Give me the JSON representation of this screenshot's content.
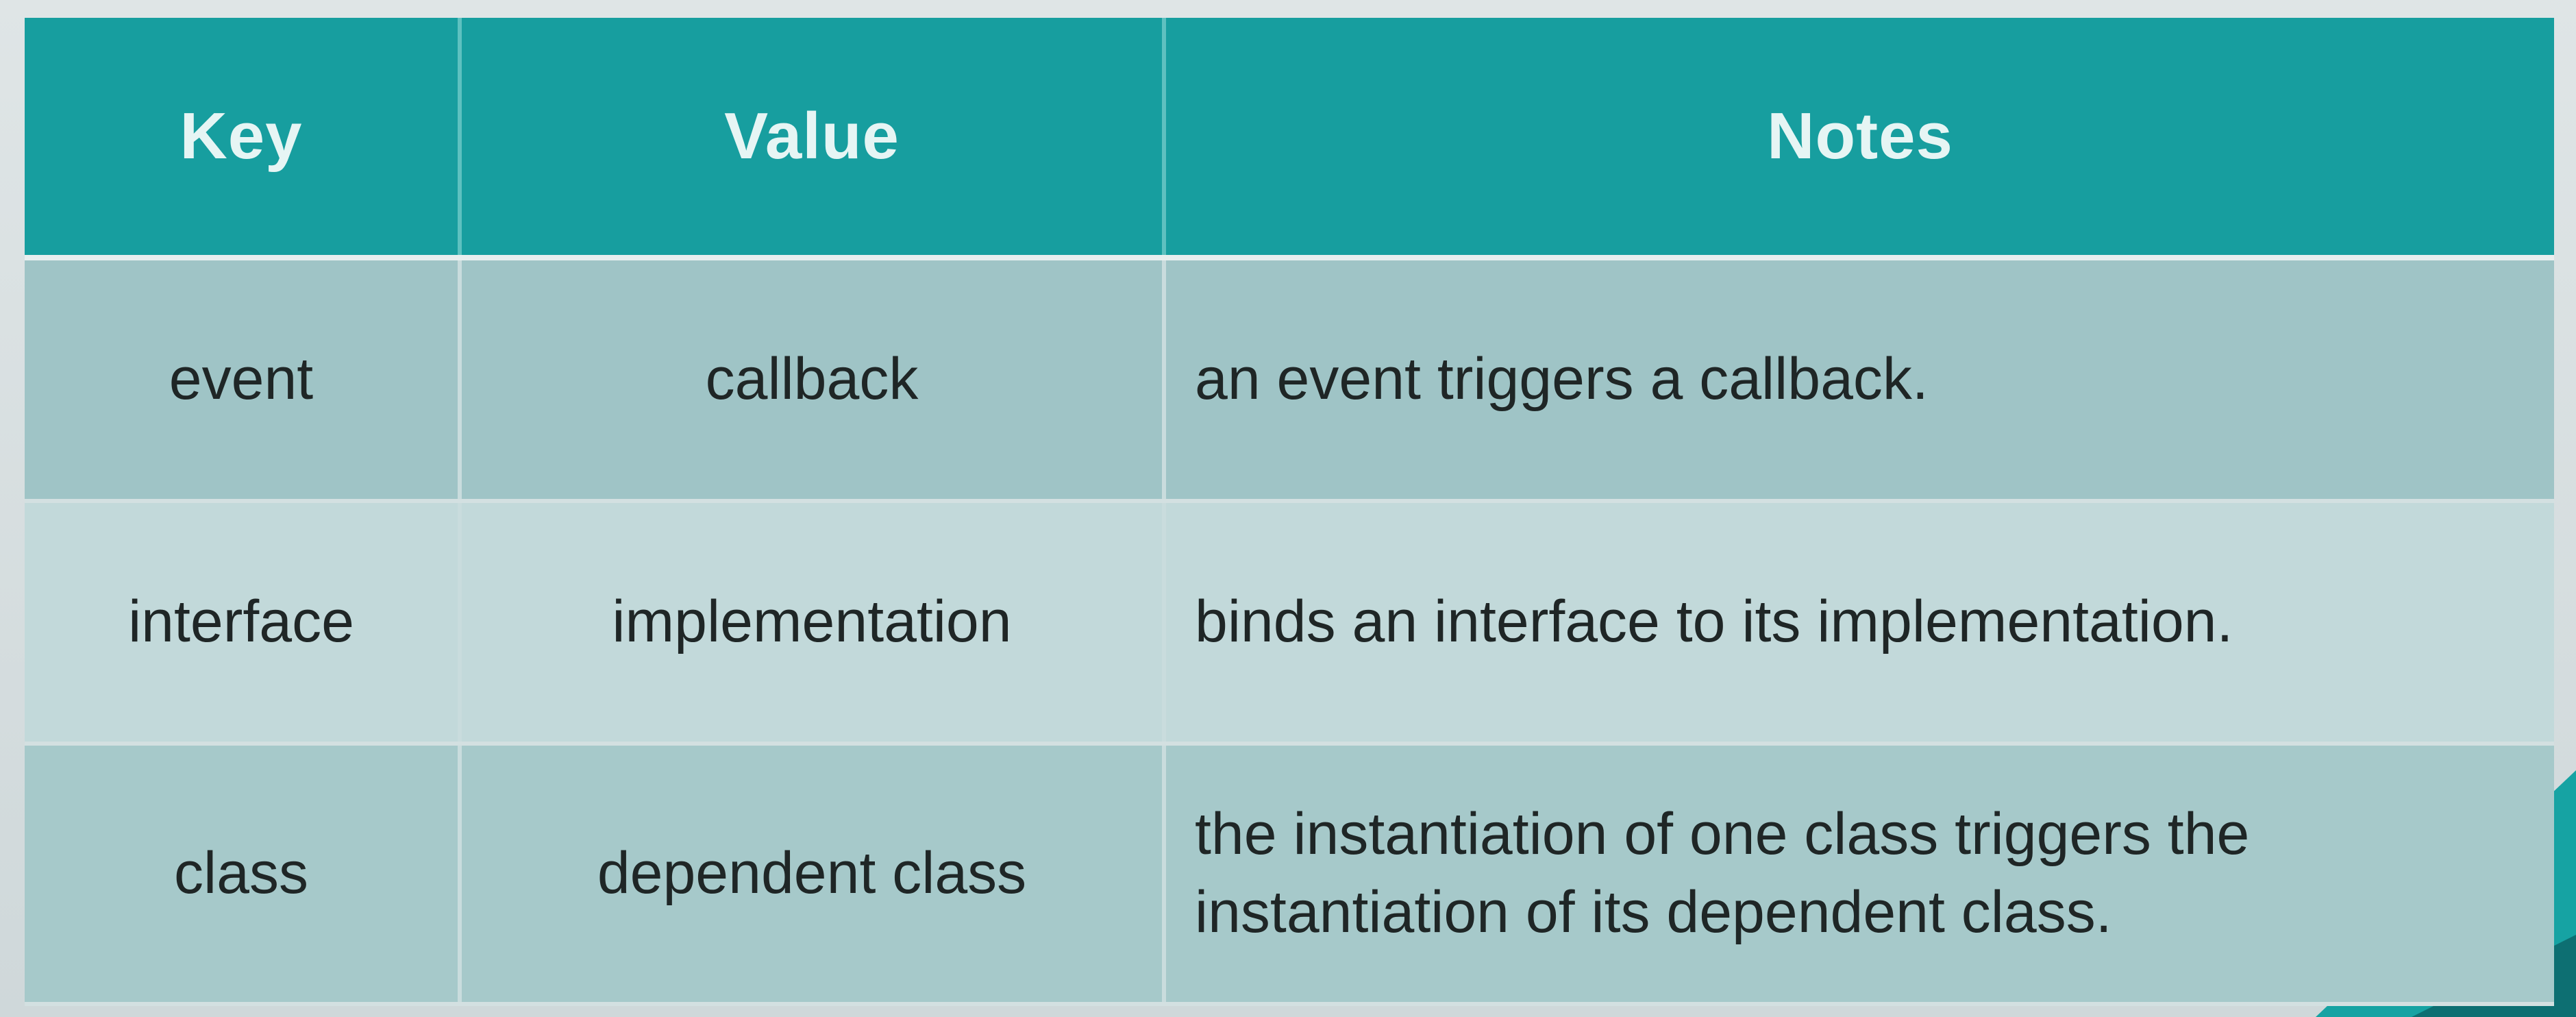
{
  "table": {
    "headers": {
      "key": "Key",
      "value": "Value",
      "notes": "Notes"
    },
    "rows": [
      {
        "key": "event",
        "value": "callback",
        "notes": "an event triggers a callback."
      },
      {
        "key": "interface",
        "value": "implementation",
        "notes": "binds an interface to its implementation."
      },
      {
        "key": "class",
        "value": "dependent class",
        "notes": "the instantiation of one class triggers the instantiation of its dependent class."
      }
    ]
  },
  "colors": {
    "header_bg": "#179e9f",
    "header_text": "#e6f5f4",
    "row_odd": "#9fc4c6",
    "row_even": "#c2d9da",
    "accent": "#16a3a3"
  }
}
